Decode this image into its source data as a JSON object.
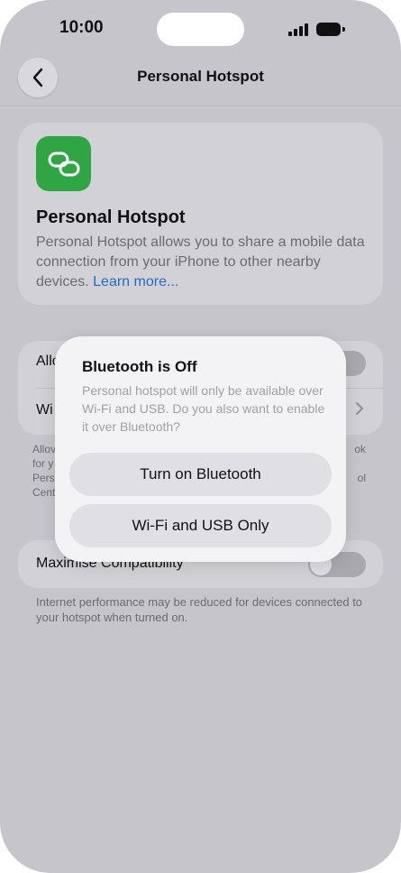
{
  "status_bar": {
    "time": "10:00"
  },
  "nav": {
    "title": "Personal Hotspot",
    "back_icon": "chevron-left-icon"
  },
  "header_card": {
    "icon": "link-icon",
    "icon_color": "#2fa544",
    "title": "Personal Hotspot",
    "description": "Personal Hotspot allows you to share a mobile data connection from your iPhone to other nearby devices.",
    "link": "Learn more..."
  },
  "settings": {
    "row1_label": "Allo",
    "row1_toggle_on": false,
    "row2_label": "Wi",
    "footer_lines": [
      {
        "left": "Allov",
        "right": "ok"
      },
      {
        "left": "for y",
        "right": ""
      },
      {
        "left": "Pers",
        "right": "ol"
      },
      {
        "left": "Cent",
        "right": ""
      }
    ]
  },
  "compatibility": {
    "label": "Maximise Compatibility",
    "toggle_on": false,
    "footer": "Internet performance may be reduced for devices connected to your hotspot when turned on."
  },
  "dialog": {
    "title": "Bluetooth is Off",
    "message": "Personal hotspot will only be available over Wi-Fi and USB. Do you also want to enable it over Bluetooth?",
    "primary_button": "Turn on Bluetooth",
    "secondary_button": "Wi-Fi and USB Only"
  },
  "colors": {
    "link": "#1f6fc4",
    "background": "#c6c5cb"
  }
}
